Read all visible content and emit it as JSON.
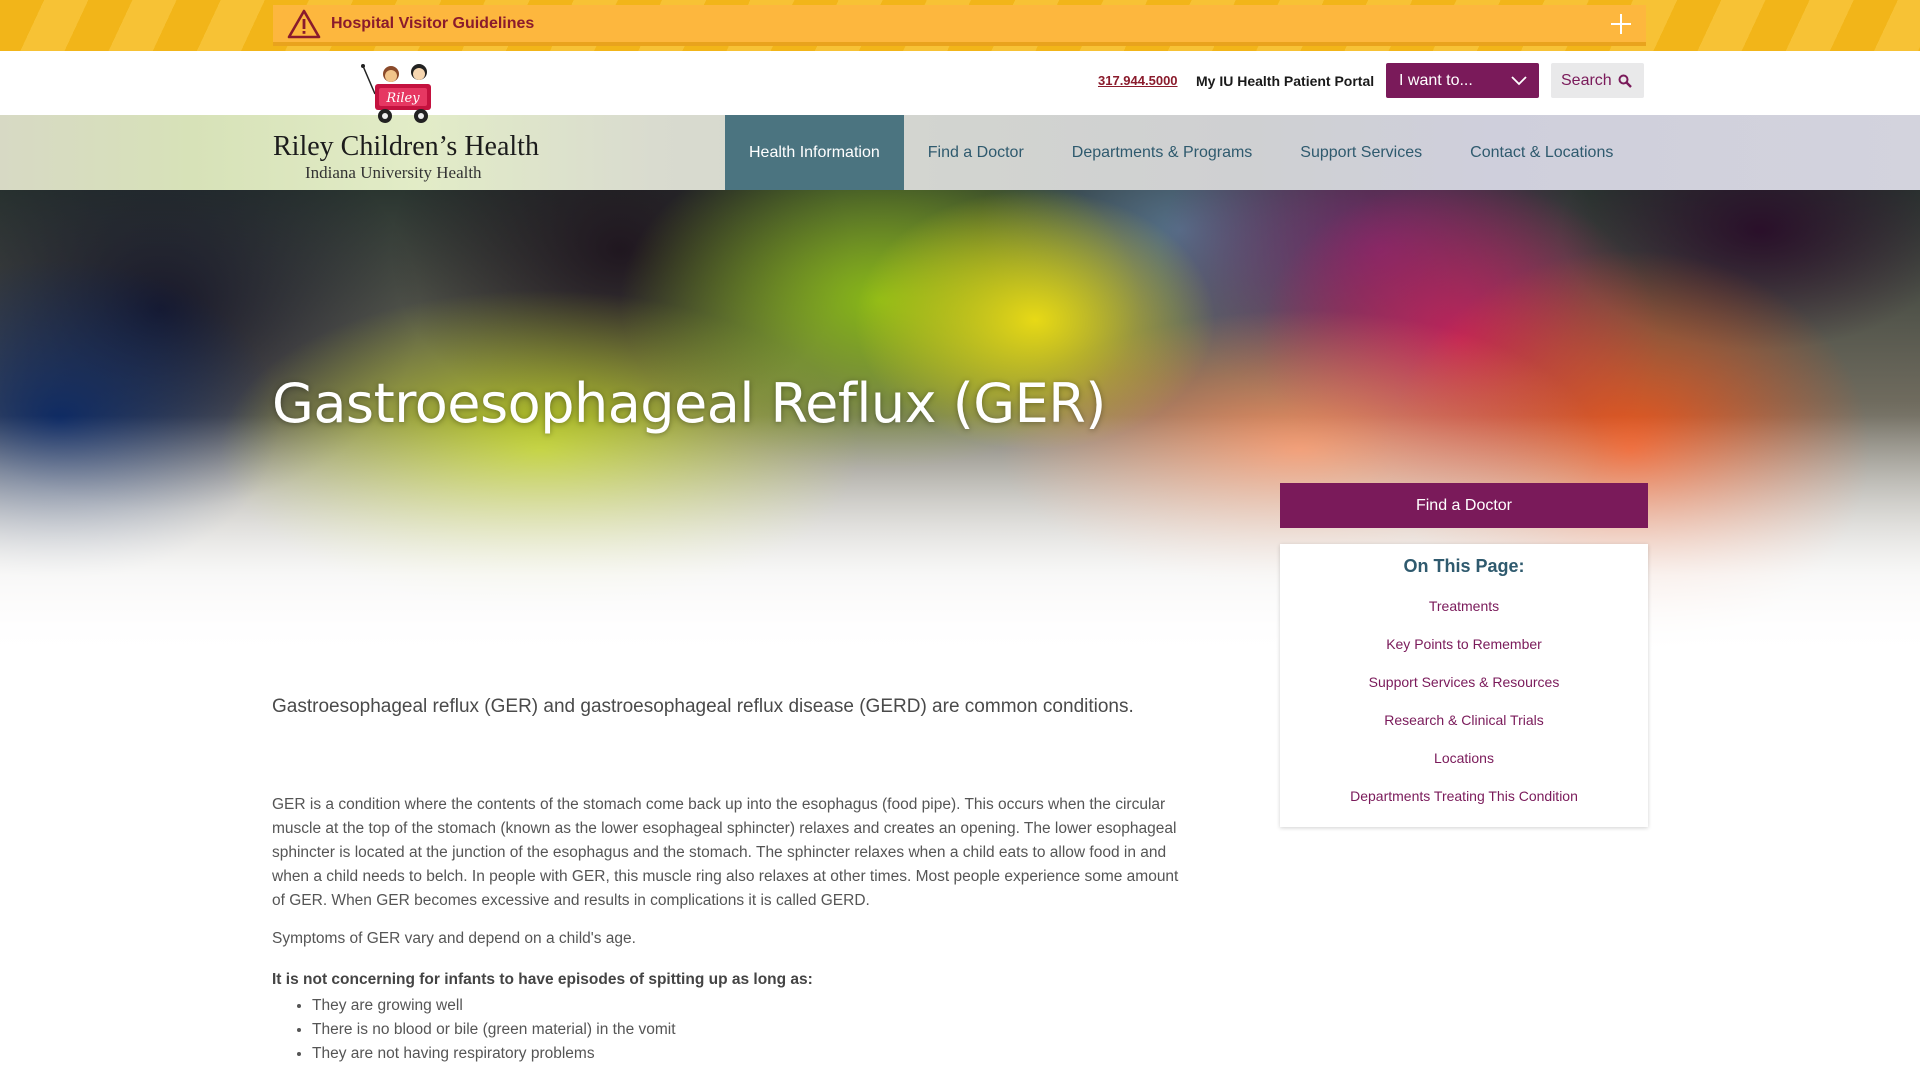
{
  "alert": {
    "title": "Hospital Visitor Guidelines"
  },
  "utility": {
    "phone": "317.944.5000",
    "portal": "My IU Health Patient Portal",
    "i_want_to": "I want to...",
    "search": "Search"
  },
  "logo": {
    "wagon_text": "Riley",
    "title": "Riley Children’s Health",
    "subtitle": "Indiana University Health"
  },
  "nav": {
    "items": [
      {
        "label": "Health Information"
      },
      {
        "label": "Find a Doctor"
      },
      {
        "label": "Departments & Programs"
      },
      {
        "label": "Support Services"
      },
      {
        "label": "Contact & Locations"
      }
    ]
  },
  "hero": {
    "title": "Gastroesophageal Reflux (GER)"
  },
  "sidebar": {
    "find_doctor": "Find a Doctor",
    "on_this_page_title": "On This Page:",
    "links": [
      "Treatments",
      "Key Points to Remember",
      "Support Services & Resources",
      "Research & Clinical Trials",
      "Locations",
      "Departments Treating This Condition"
    ]
  },
  "content": {
    "intro": "Gastroesophageal reflux (GER) and gastroesophageal reflux disease (GERD) are common conditions.",
    "paragraph1": "GER is a condition where the contents of the stomach come back up into the esophagus (food pipe). This occurs when the circular muscle at the top of the stomach (known as the lower esophageal sphincter) relaxes and creates an opening. The lower esophageal sphincter is located at the junction of the esophagus and the stomach. The sphincter relaxes when a child eats to allow food in and when a child needs to belch. In people with GER, this muscle ring also relaxes at other times. Most people experience some amount of GER. When GER becomes excessive and results in complications it is called GERD.",
    "paragraph2": "Symptoms of GER vary and depend on a child's age.",
    "bold_lead": "It is not concerning for infants to have episodes of spitting up as long as:",
    "bullets": [
      "They are growing well",
      "There is no blood or bile (green material) in the vomit",
      "They are not having respiratory problems"
    ]
  },
  "colors": {
    "brand_purple": "#7a1a5a",
    "nav_active": "#4b7480",
    "alert_yellow": "#fdb73e",
    "alert_text": "#8a1b2c"
  },
  "icons": [
    "warning-icon",
    "plus-icon",
    "chevron-down-icon",
    "search-icon",
    "riley-wagon-logo"
  ]
}
